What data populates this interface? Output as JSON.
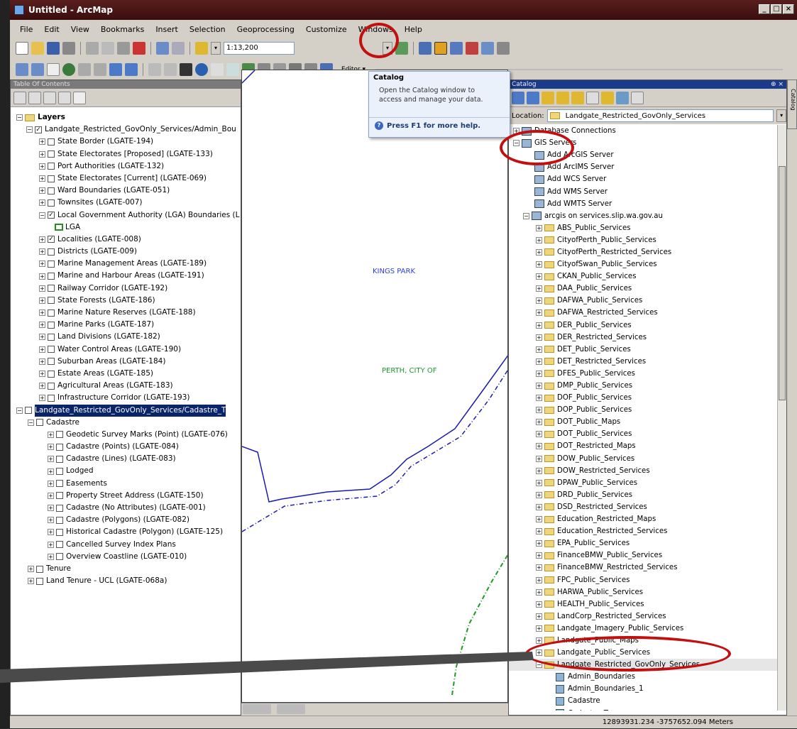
{
  "window": {
    "title": "Untitled - ArcMap"
  },
  "menu": [
    "File",
    "Edit",
    "View",
    "Bookmarks",
    "Insert",
    "Selection",
    "Geoprocessing",
    "Customize",
    "Windows",
    "Help"
  ],
  "toolbar": {
    "scale": "1:13,200",
    "editor": "Editor ▾"
  },
  "toc": {
    "title": "Table Of Contents",
    "root": "Layers",
    "group1": "Landgate_Restricted_GovOnly_Services/Admin_Bou",
    "admin_layers": [
      {
        "label": "State Border (LGATE-194)",
        "checked": false
      },
      {
        "label": "State Electorates [Proposed] (LGATE-133)",
        "checked": false
      },
      {
        "label": "Port Authorities (LGATE-132)",
        "checked": false
      },
      {
        "label": "State Electorates [Current] (LGATE-069)",
        "checked": false
      },
      {
        "label": "Ward Boundaries (LGATE-051)",
        "checked": false
      },
      {
        "label": "Townsites (LGATE-007)",
        "checked": false
      },
      {
        "label": "Local Government Authority (LGA) Boundaries (L",
        "checked": true
      }
    ],
    "lga": "LGA",
    "admin_layers2": [
      {
        "label": "Localities (LGATE-008)",
        "checked": true
      },
      {
        "label": "Districts (LGATE-009)",
        "checked": false
      },
      {
        "label": "Marine Management Areas (LGATE-189)",
        "checked": false
      },
      {
        "label": "Marine and Harbour Areas (LGATE-191)",
        "checked": false
      },
      {
        "label": "Railway Corridor (LGATE-192)",
        "checked": false
      },
      {
        "label": "State Forests (LGATE-186)",
        "checked": false
      },
      {
        "label": "Marine Nature Reserves (LGATE-188)",
        "checked": false
      },
      {
        "label": "Marine Parks (LGATE-187)",
        "checked": false
      },
      {
        "label": "Land Divisions (LGATE-182)",
        "checked": false
      },
      {
        "label": "Water Control Areas (LGATE-190)",
        "checked": false
      },
      {
        "label": "Suburban Areas (LGATE-184)",
        "checked": false
      },
      {
        "label": "Estate Areas (LGATE-185)",
        "checked": false
      },
      {
        "label": "Agricultural Areas (LGATE-183)",
        "checked": false
      },
      {
        "label": "Infrastructure Corridor (LGATE-193)",
        "checked": false
      }
    ],
    "group2": "Landgate_Restricted_GovOnly_Services/Cadastre_T",
    "cadastre": "Cadastre",
    "cadastre_layers": [
      "Geodetic Survey Marks (Point) (LGATE-076)",
      "Cadastre (Points) (LGATE-084)",
      "Cadastre (Lines) (LGATE-083)",
      "Lodged",
      "Easements",
      "Property Street Address (LGATE-150)",
      "Cadastre (No Attributes) (LGATE-001)",
      "Cadastre (Polygons) (LGATE-082)",
      "Historical Cadastre (Polygon) (LGATE-125)",
      "Cancelled Survey Index Plans",
      "Overview Coastline (LGATE-010)"
    ],
    "tenure": "Tenure",
    "land_tenure": "Land Tenure - UCL (LGATE-068a)"
  },
  "map": {
    "labels": [
      "KINGS PARK",
      "PERTH, CITY OF"
    ]
  },
  "tooltip": {
    "title": "Catalog",
    "body": "Open the Catalog window to access and manage your data.",
    "help": "Press F1 for more help."
  },
  "catalog": {
    "title": "Catalog",
    "location_label": "Location:",
    "location": "Landgate_Restricted_GovOnly_Services",
    "db": "Database Connections",
    "gis": "GIS Servers",
    "server_actions": [
      "Add ArcGIS Server",
      "Add ArcIMS Server",
      "Add WCS Server",
      "Add WMS Server",
      "Add WMTS Server"
    ],
    "server": "arcgis on services.slip.wa.gov.au",
    "folders": [
      "ABS_Public_Services",
      "CityofPerth_Public_Services",
      "CityofPerth_Restricted_Services",
      "CityofSwan_Public_Services",
      "CKAN_Public_Services",
      "DAA_Public_Services",
      "DAFWA_Public_Services",
      "DAFWA_Restricted_Services",
      "DER_Public_Services",
      "DER_Restricted_Services",
      "DET_Public_Services",
      "DET_Restricted_Services",
      "DFES_Public_Services",
      "DMP_Public_Services",
      "DOF_Public_Services",
      "DOP_Public_Services",
      "DOT_Public_Maps",
      "DOT_Public_Services",
      "DOT_Restricted_Maps",
      "DOW_Public_Services",
      "DOW_Restricted_Services",
      "DPAW_Public_Services",
      "DRD_Public_Services",
      "DSD_Restricted_Services",
      "Education_Restricted_Maps",
      "Education_Restricted_Services",
      "EPA_Public_Services",
      "FinanceBMW_Public_Services",
      "FinanceBMW_Restricted_Services",
      "FPC_Public_Services",
      "HARWA_Public_Services",
      "HEALTH_Public_Services",
      "LandCorp_Restricted_Services",
      "Landgate_Imagery_Public_Services",
      "Landgate_Public_Maps",
      "Landgate_Public_Services",
      "Landgate_Restricted_GovOnly_Services"
    ],
    "children": [
      "Admin_Boundaries",
      "Admin_Boundaries_1",
      "Cadastre",
      "Cadastre_Tenure"
    ],
    "sidetab": "Catalog"
  },
  "status": {
    "coords": "12893931.234  -3757652.094 Meters"
  }
}
